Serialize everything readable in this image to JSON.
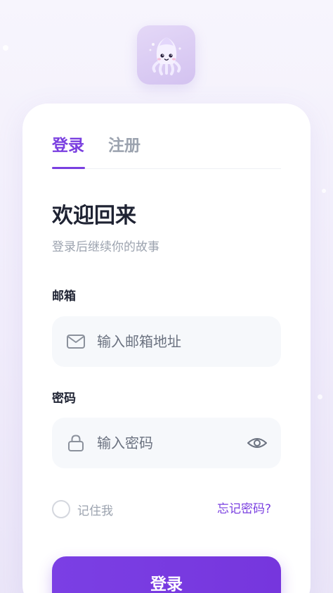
{
  "app": {
    "logo_icon": "squid-mascot-icon",
    "accent_color": "#7a3fe0"
  },
  "tabs": {
    "items": [
      {
        "label": "登录",
        "active": true
      },
      {
        "label": "注册",
        "active": false
      }
    ]
  },
  "header": {
    "title": "欢迎回来",
    "subtitle": "登录后继续你的故事"
  },
  "form": {
    "email": {
      "label": "邮箱",
      "placeholder": "输入邮箱地址",
      "value": "",
      "icon": "mail-icon"
    },
    "password": {
      "label": "密码",
      "placeholder": "输入密码",
      "value": "",
      "icon": "lock-icon",
      "toggle_icon": "eye-icon"
    },
    "remember_label": "记住我",
    "remember_checked": false,
    "forgot_label": "忘记密码?",
    "submit_label": "登录"
  }
}
